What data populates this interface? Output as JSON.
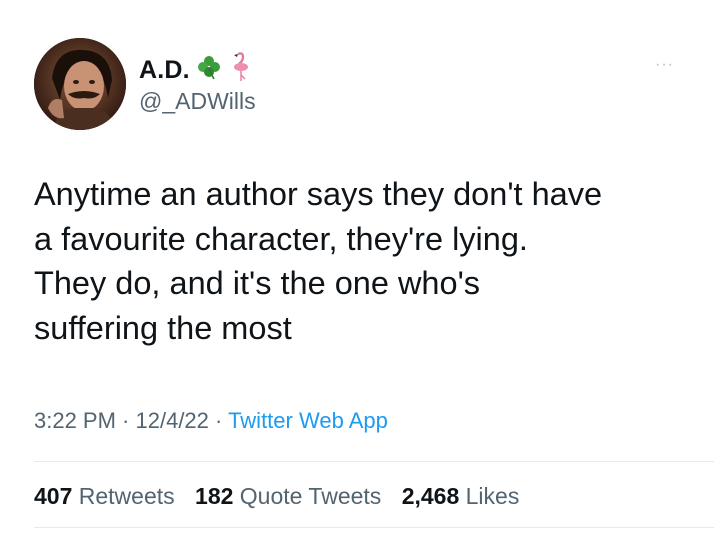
{
  "author": {
    "display_name": "A.D.",
    "handle": "@_ADWills",
    "name_emojis": [
      "clover-emoji",
      "flamingo-emoji"
    ]
  },
  "more_glyph": "···",
  "tweet": {
    "text": "Anytime an author says they don't have\na favourite character, they're lying.\nThey do, and it's the one who's\nsuffering the most"
  },
  "meta": {
    "time": "3:22 PM",
    "sep1": " · ",
    "date": "12/4/22",
    "sep2": " · ",
    "source": "Twitter Web App"
  },
  "stats": {
    "retweets_count": "407",
    "retweets_label": "Retweets",
    "quotes_count": "182",
    "quotes_label": "Quote Tweets",
    "likes_count": "2,468",
    "likes_label": "Likes"
  },
  "colors": {
    "text": "#0f1419",
    "secondary": "#536471",
    "link": "#1d9bf0",
    "divider": "#e7e9ea"
  }
}
